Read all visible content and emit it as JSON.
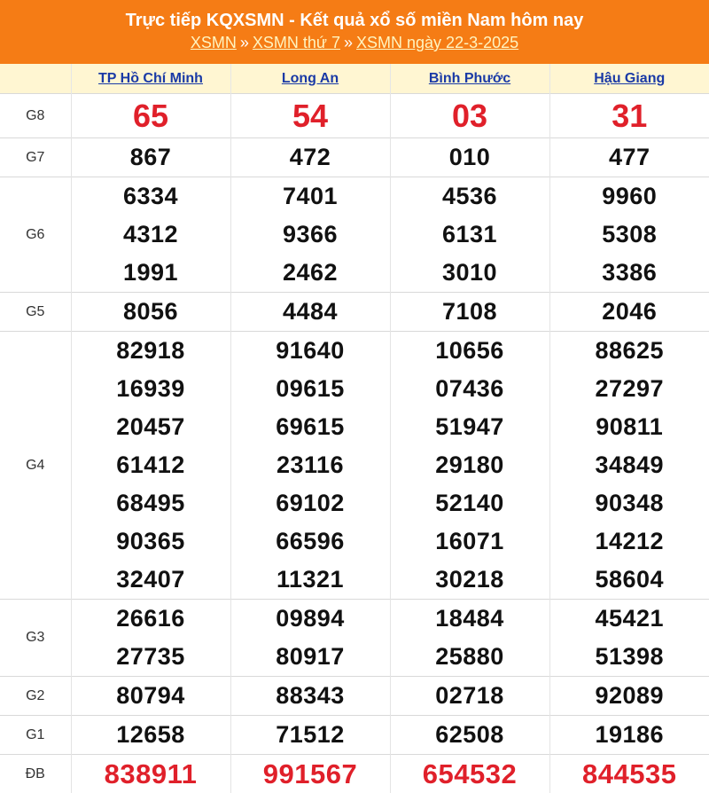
{
  "header": {
    "title": "Trực tiếp KQXSMN - Kết quả xổ số miền Nam hôm nay",
    "crumb1": "XSMN",
    "crumb2": "XSMN thứ 7",
    "crumb3": "XSMN ngày 22-3-2025",
    "separator": "»",
    "background": "#f57c15"
  },
  "provinces": [
    "TP Hồ Chí Minh",
    "Long An",
    "Bình Phước",
    "Hậu Giang"
  ],
  "prizes": [
    {
      "label": "G8",
      "results": [
        [
          "65"
        ],
        [
          "54"
        ],
        [
          "03"
        ],
        [
          "31"
        ]
      ]
    },
    {
      "label": "G7",
      "results": [
        [
          "867"
        ],
        [
          "472"
        ],
        [
          "010"
        ],
        [
          "477"
        ]
      ]
    },
    {
      "label": "G6",
      "results": [
        [
          "6334",
          "4312",
          "1991"
        ],
        [
          "7401",
          "9366",
          "2462"
        ],
        [
          "4536",
          "6131",
          "3010"
        ],
        [
          "9960",
          "5308",
          "3386"
        ]
      ]
    },
    {
      "label": "G5",
      "results": [
        [
          "8056"
        ],
        [
          "4484"
        ],
        [
          "7108"
        ],
        [
          "2046"
        ]
      ]
    },
    {
      "label": "G4",
      "results": [
        [
          "82918",
          "16939",
          "20457",
          "61412",
          "68495",
          "90365",
          "32407"
        ],
        [
          "91640",
          "09615",
          "69615",
          "23116",
          "69102",
          "66596",
          "11321"
        ],
        [
          "10656",
          "07436",
          "51947",
          "29180",
          "52140",
          "16071",
          "30218"
        ],
        [
          "88625",
          "27297",
          "90811",
          "34849",
          "90348",
          "14212",
          "58604"
        ]
      ]
    },
    {
      "label": "G3",
      "results": [
        [
          "26616",
          "27735"
        ],
        [
          "09894",
          "80917"
        ],
        [
          "18484",
          "25880"
        ],
        [
          "45421",
          "51398"
        ]
      ]
    },
    {
      "label": "G2",
      "results": [
        [
          "80794"
        ],
        [
          "88343"
        ],
        [
          "02718"
        ],
        [
          "92089"
        ]
      ]
    },
    {
      "label": "G1",
      "results": [
        [
          "12658"
        ],
        [
          "71512"
        ],
        [
          "62508"
        ],
        [
          "19186"
        ]
      ]
    },
    {
      "label": "ĐB",
      "results": [
        [
          "838911"
        ],
        [
          "991567"
        ],
        [
          "654532"
        ],
        [
          "844535"
        ]
      ]
    }
  ],
  "colors": {
    "highlight": "#e0202a",
    "link": "#1a3aa6",
    "header_row": "#fff6d2"
  }
}
